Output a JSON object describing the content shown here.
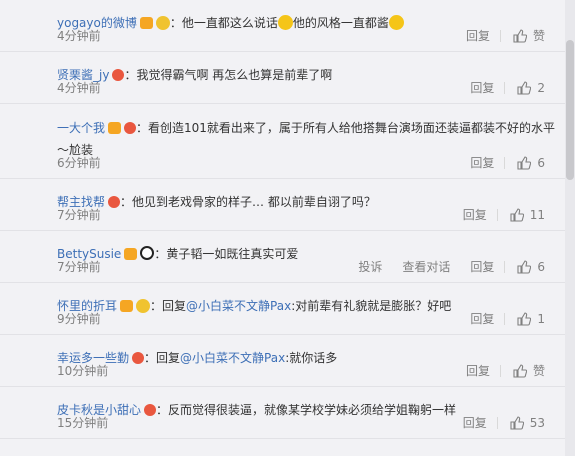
{
  "comments": [
    {
      "user": "yogayo的微博",
      "badges": [
        "vip",
        "gold"
      ],
      "parts": [
        {
          "type": "text",
          "value": "他一直都这么说话"
        },
        {
          "type": "emoji",
          "name": "laugh-emoji"
        },
        {
          "type": "text",
          "value": "他的风格一直都酱"
        },
        {
          "type": "emoji",
          "name": "laugh-emoji"
        }
      ],
      "time": "4分钟前",
      "reply_label": "回复",
      "like_label": "赞",
      "tall": false
    },
    {
      "user": "贤栗酱_jy",
      "badges": [
        "lvl"
      ],
      "parts": [
        {
          "type": "text",
          "value": "我觉得霸气啊 再怎么也算是前辈了啊"
        }
      ],
      "time": "4分钟前",
      "reply_label": "回复",
      "like_label": "2",
      "tall": false
    },
    {
      "user": "一大个我",
      "badges": [
        "vip",
        "lvl"
      ],
      "parts": [
        {
          "type": "text",
          "value": "看创造101就看出来了，属于所有人给他搭舞台演场面还装逼都装不好的水平～尬装"
        }
      ],
      "time": "6分钟前",
      "reply_label": "回复",
      "like_label": "6",
      "tall": true
    },
    {
      "user": "帮主找帮",
      "badges": [
        "lvl"
      ],
      "parts": [
        {
          "type": "text",
          "value": "他见到老戏骨家的样子… 都以前辈自诩了吗？"
        }
      ],
      "time": "7分钟前",
      "reply_label": "回复",
      "like_label": "11",
      "tall": false
    },
    {
      "user": "BettySusie",
      "badges": [
        "vip",
        "panda"
      ],
      "parts": [
        {
          "type": "text",
          "value": "黄子韬一如既往真实可爱"
        }
      ],
      "time": "7分钟前",
      "extra_actions": [
        "投诉",
        "查看对话"
      ],
      "reply_label": "回复",
      "like_label": "6",
      "tall": false
    },
    {
      "user": "怀里的折耳",
      "badges": [
        "vip",
        "gold"
      ],
      "parts": [
        {
          "type": "text",
          "value": "回复"
        },
        {
          "type": "mention",
          "value": "@小白菜不文静Pax"
        },
        {
          "type": "text",
          "value": ":对前辈有礼貌就是膨胀？好吧"
        }
      ],
      "time": "9分钟前",
      "reply_label": "回复",
      "like_label": "1",
      "tall": false
    },
    {
      "user": "幸运多一些勤",
      "badges": [
        "lvl"
      ],
      "parts": [
        {
          "type": "text",
          "value": "回复"
        },
        {
          "type": "mention",
          "value": "@小白菜不文静Pax"
        },
        {
          "type": "text",
          "value": ":就你话多"
        }
      ],
      "time": "10分钟前",
      "reply_label": "回复",
      "like_label": "赞",
      "tall": false
    },
    {
      "user": "皮卡秋是小甜心",
      "badges": [
        "lvl"
      ],
      "parts": [
        {
          "type": "text",
          "value": "反而觉得很装逼，就像某学校学妹必须给学姐鞠躬一样"
        }
      ],
      "time": "15分钟前",
      "reply_label": "回复",
      "like_label": "53",
      "tall": false
    }
  ],
  "colors": {
    "background": "#f2f2f5",
    "username": "#3d6fb6",
    "meta": "#808080"
  }
}
